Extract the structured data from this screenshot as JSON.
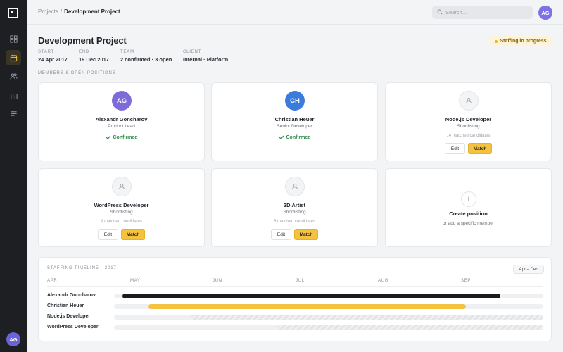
{
  "app": {
    "user_initials": "AG"
  },
  "sidebar": {
    "items": [
      {
        "icon": "grid-icon",
        "active": false
      },
      {
        "icon": "calendar-icon",
        "active": true
      },
      {
        "icon": "users-icon",
        "active": false
      },
      {
        "icon": "chart-icon",
        "active": false
      },
      {
        "icon": "list-icon",
        "active": false
      }
    ]
  },
  "topbar": {
    "breadcrumb_root": "Projects",
    "breadcrumb_sep": "/",
    "breadcrumb_current": "Development Project",
    "search_placeholder": "Search..."
  },
  "project": {
    "title": "Development Project",
    "status": "Staffing in progress",
    "meta": [
      {
        "key": "START",
        "value": "24 Apr 2017"
      },
      {
        "key": "END",
        "value": "19 Dec 2017"
      },
      {
        "key": "TEAM",
        "value": "2 confirmed · 3 open"
      },
      {
        "key": "CLIENT",
        "value": "Internal · Platform"
      }
    ]
  },
  "section_label": "MEMBERS & OPEN POSITIONS",
  "cards": [
    {
      "type": "member",
      "initials": "AG",
      "color": "#7d6bd9",
      "name": "Alexandr Goncharov",
      "role": "Product Lead",
      "status": "Confirmed"
    },
    {
      "type": "member",
      "initials": "CH",
      "color": "#3b7bdb",
      "name": "Christian Heuer",
      "role": "Senior Developer",
      "status": "Confirmed"
    },
    {
      "type": "position",
      "name": "Node.js Developer",
      "role": "Shortlisting",
      "matched": "14 matched candidates",
      "edit": "Edit",
      "match": "Match"
    },
    {
      "type": "position",
      "name": "WordPress Developer",
      "role": "Shortlisting",
      "matched": "9 matched candidates",
      "edit": "Edit",
      "match": "Match"
    },
    {
      "type": "position",
      "name": "3D Artist",
      "role": "Shortlisting",
      "matched": "6 matched candidates",
      "edit": "Edit",
      "match": "Match"
    },
    {
      "type": "create",
      "name": "Create position",
      "sub": "or add a specific member",
      "plus": "+"
    }
  ],
  "timeline": {
    "title": "STAFFING TIMELINE · 2017",
    "range": "Apr – Dec",
    "months": [
      "APR",
      "MAY",
      "JUN",
      "JUL",
      "AUG",
      "SEP"
    ],
    "rows": [
      {
        "label": "Alexandr Goncharov",
        "style": "dark",
        "start": 0.02,
        "end": 0.9
      },
      {
        "label": "Christian Heuer",
        "style": "yellow",
        "start": 0.08,
        "end": 0.82
      },
      {
        "label": "Node.js Developer",
        "style": "hatch",
        "start": 0.18,
        "end": 1.0
      },
      {
        "label": "WordPress Developer",
        "style": "hatch",
        "start": 0.38,
        "end": 1.0
      }
    ]
  }
}
